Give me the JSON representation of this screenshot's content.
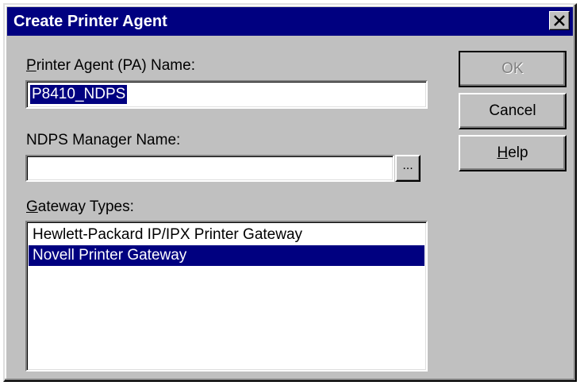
{
  "window": {
    "title": "Create Printer Agent",
    "close_glyph": "close-icon"
  },
  "pa_name": {
    "label_accel": "P",
    "label_rest": "rinter Agent (PA) Name:",
    "value": "P8410_NDPS"
  },
  "manager": {
    "label": "NDPS Manager Name:",
    "value": "",
    "browse_label": "..."
  },
  "gateway": {
    "label_accel": "G",
    "label_rest": "ateway Types:",
    "items": [
      {
        "label": "Hewlett-Packard IP/IPX Printer Gateway",
        "selected": false
      },
      {
        "label": "Novell Printer Gateway",
        "selected": true
      }
    ]
  },
  "buttons": {
    "ok": "OK",
    "cancel": "Cancel",
    "help_accel": "H",
    "help_rest": "elp"
  },
  "colors": {
    "titlebar": "#000080",
    "face": "#c0c0c0",
    "selection": "#000080"
  }
}
